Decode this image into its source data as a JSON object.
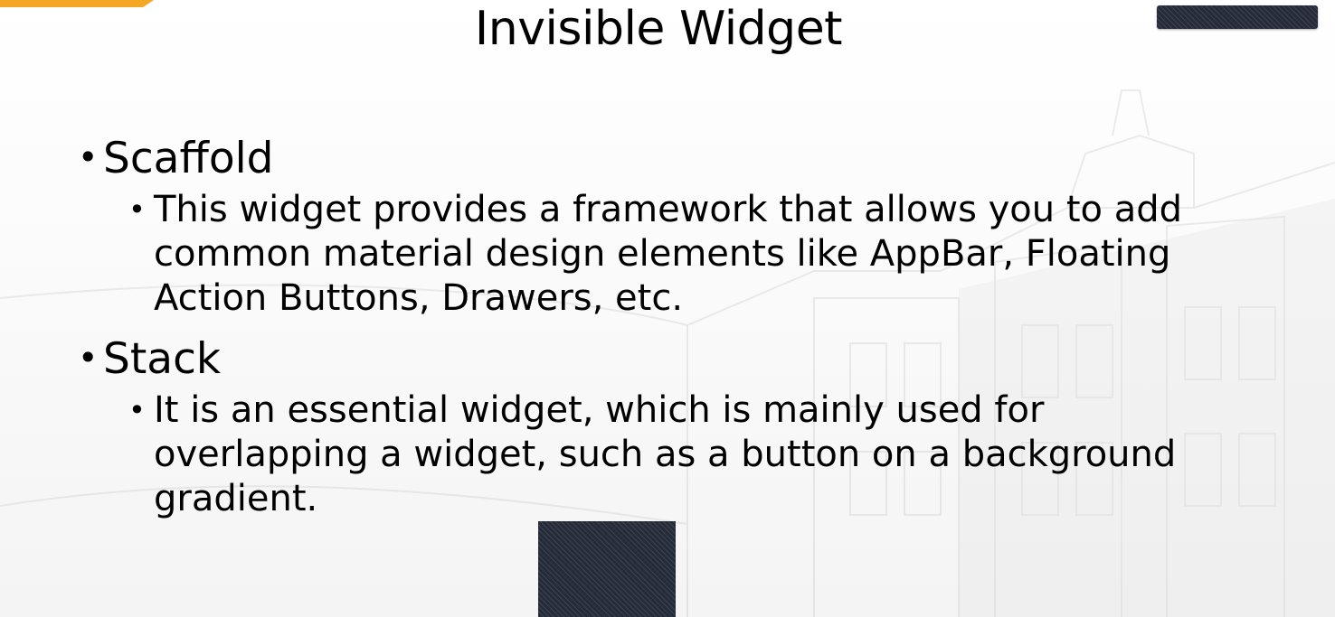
{
  "slide": {
    "title": "Invisible Widget",
    "bullet_glyph": "•",
    "items": [
      {
        "heading": "Scaffold",
        "description": "This widget provides a framework that allows you to add common material design elements like AppBar, Floating Action Buttons, Drawers, etc."
      },
      {
        "heading": "Stack",
        "description": "It is an essential widget, which is mainly used for overlapping a widget, such as a button on a background gradient."
      }
    ]
  },
  "colors": {
    "accent": "#f5a623",
    "dark_block": "#2b3140",
    "text": "#000000"
  }
}
